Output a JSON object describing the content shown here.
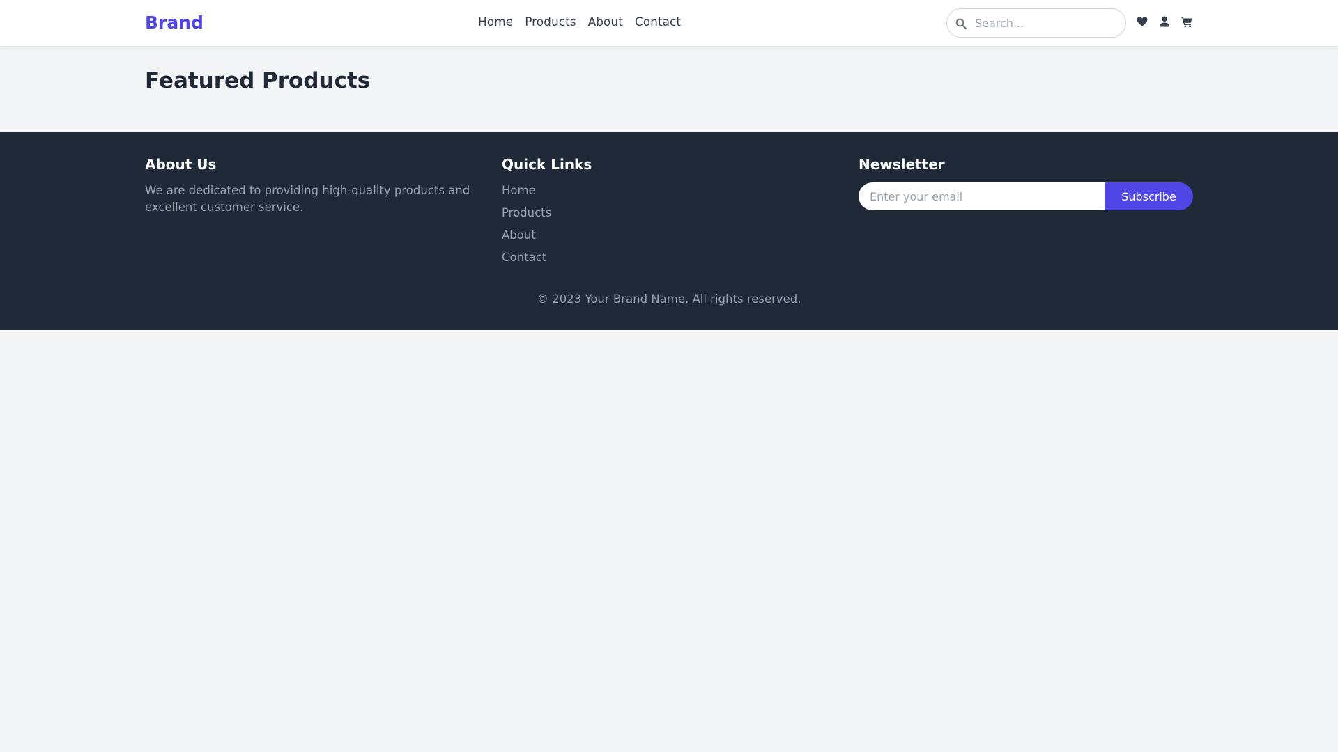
{
  "header": {
    "brand": "Brand",
    "nav": [
      "Home",
      "Products",
      "About",
      "Contact"
    ],
    "search_placeholder": "Search...",
    "icons": [
      "search-icon",
      "heart-icon",
      "user-icon",
      "cart-icon"
    ]
  },
  "main": {
    "title": "Featured Products"
  },
  "footer": {
    "about": {
      "title": "About Us",
      "text": "We are dedicated to providing high-quality products and excellent customer service."
    },
    "quick_links": {
      "title": "Quick Links",
      "items": [
        "Home",
        "Products",
        "About",
        "Contact"
      ]
    },
    "newsletter": {
      "title": "Newsletter",
      "placeholder": "Enter your email",
      "button": "Subscribe"
    },
    "copyright": "© 2023 Your Brand Name. All rights reserved."
  },
  "colors": {
    "accent": "#4f46e5",
    "footer_bg": "#1f2937",
    "page_bg": "#f3f4f6",
    "muted_text": "#9ca3af"
  }
}
